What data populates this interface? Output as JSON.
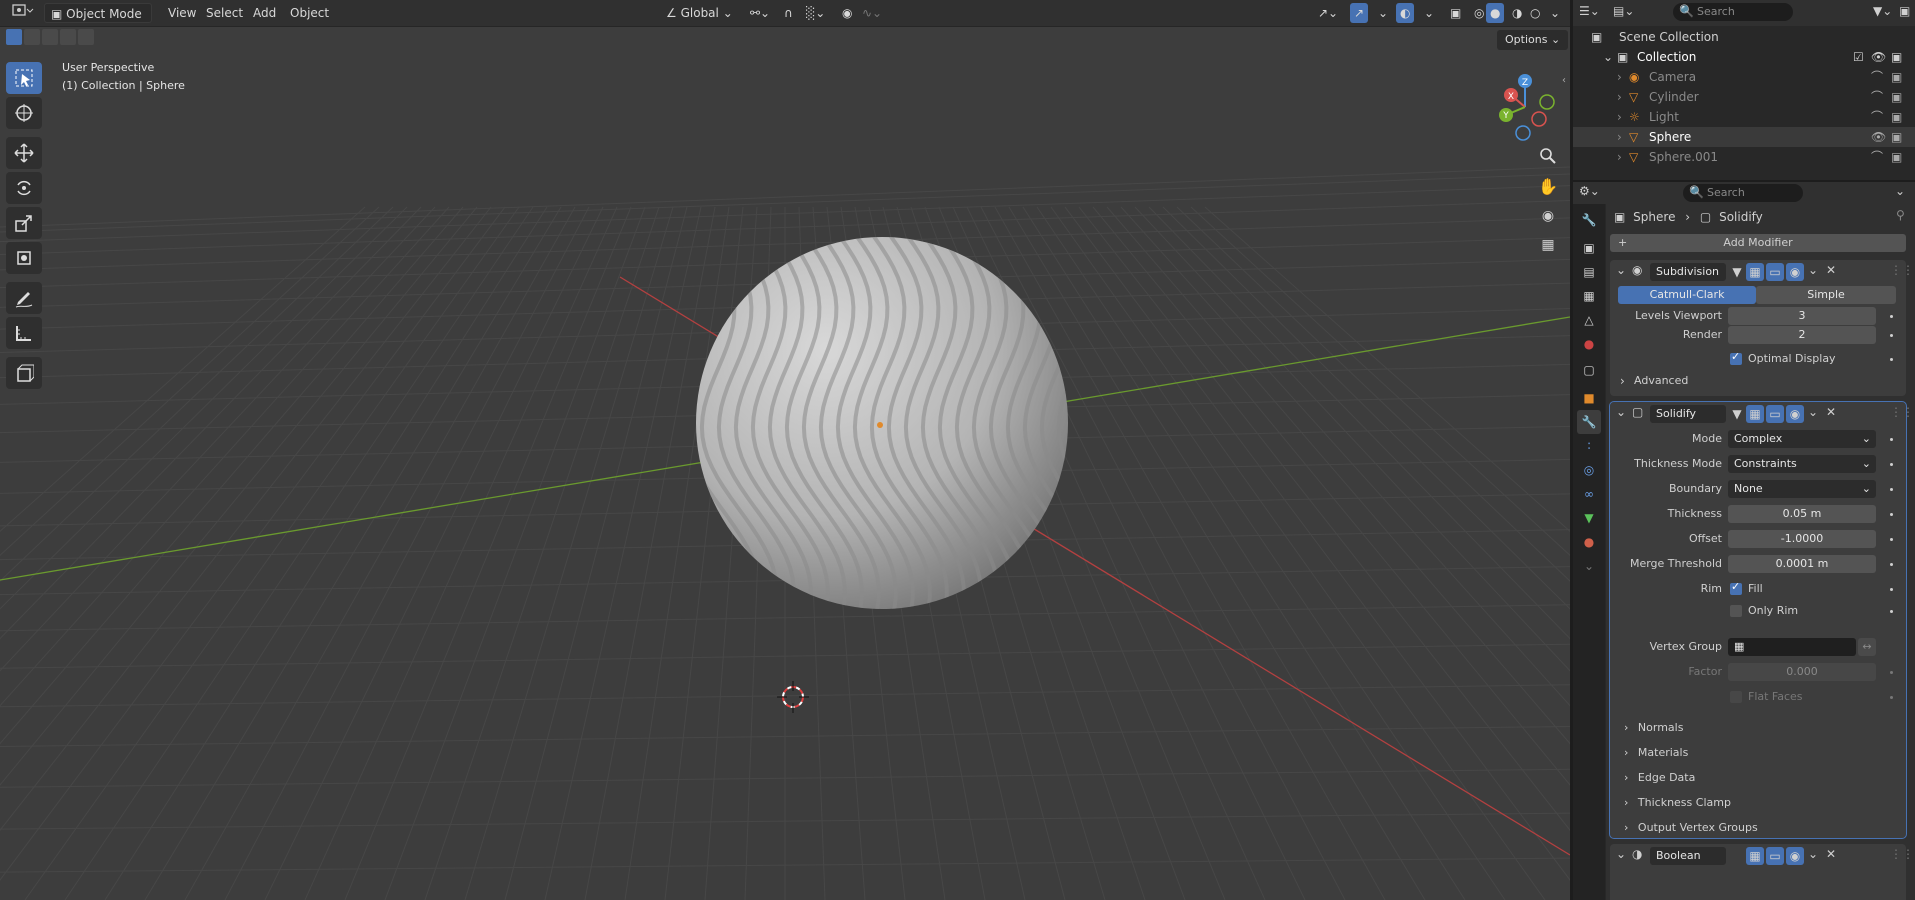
{
  "header": {
    "mode": "Object Mode",
    "menu": [
      "View",
      "Select",
      "Add",
      "Object"
    ],
    "transform_orientation": "Global"
  },
  "viewport": {
    "perspective_label": "User Perspective",
    "collection_label": "(1) Collection | Sphere",
    "options_label": "Options"
  },
  "outliner": {
    "search_placeholder": "Search",
    "scene_collection": "Scene Collection",
    "collection": "Collection",
    "items": [
      {
        "name": "Camera",
        "icon": "camera-icon",
        "selected": false
      },
      {
        "name": "Cylinder",
        "icon": "mesh-icon",
        "selected": false
      },
      {
        "name": "Light",
        "icon": "light-icon",
        "selected": false
      },
      {
        "name": "Sphere",
        "icon": "mesh-icon",
        "selected": true
      },
      {
        "name": "Sphere.001",
        "icon": "mesh-icon",
        "selected": false
      }
    ]
  },
  "properties": {
    "search_placeholder": "Search",
    "breadcrumb": {
      "object": "Sphere",
      "modifier": "Solidify"
    },
    "add_modifier": "Add Modifier",
    "subdivision": {
      "name": "Subdivision",
      "type_options": [
        "Catmull-Clark",
        "Simple"
      ],
      "levels_viewport_label": "Levels Viewport",
      "levels_viewport": "3",
      "render_label": "Render",
      "render": "2",
      "optimal_display": "Optimal Display",
      "advanced": "Advanced"
    },
    "solidify": {
      "name": "Solidify",
      "mode_label": "Mode",
      "mode": "Complex",
      "thickness_mode_label": "Thickness Mode",
      "thickness_mode": "Constraints",
      "boundary_label": "Boundary",
      "boundary": "None",
      "thickness_label": "Thickness",
      "thickness": "0.05 m",
      "offset_label": "Offset",
      "offset": "-1.0000",
      "merge_label": "Merge Threshold",
      "merge": "0.0001 m",
      "rim_label": "Rim",
      "fill": "Fill",
      "only_rim": "Only Rim",
      "vertex_group_label": "Vertex Group",
      "factor_label": "Factor",
      "factor": "0.000",
      "flat_faces": "Flat Faces",
      "sections": [
        "Normals",
        "Materials",
        "Edge Data",
        "Thickness Clamp",
        "Output Vertex Groups"
      ]
    },
    "boolean": {
      "name": "Boolean"
    }
  },
  "colors": {
    "accent": "#4772b3",
    "x_axis": "#d9534f",
    "y_axis": "#7ab32e",
    "z_axis": "#4a90d9"
  }
}
